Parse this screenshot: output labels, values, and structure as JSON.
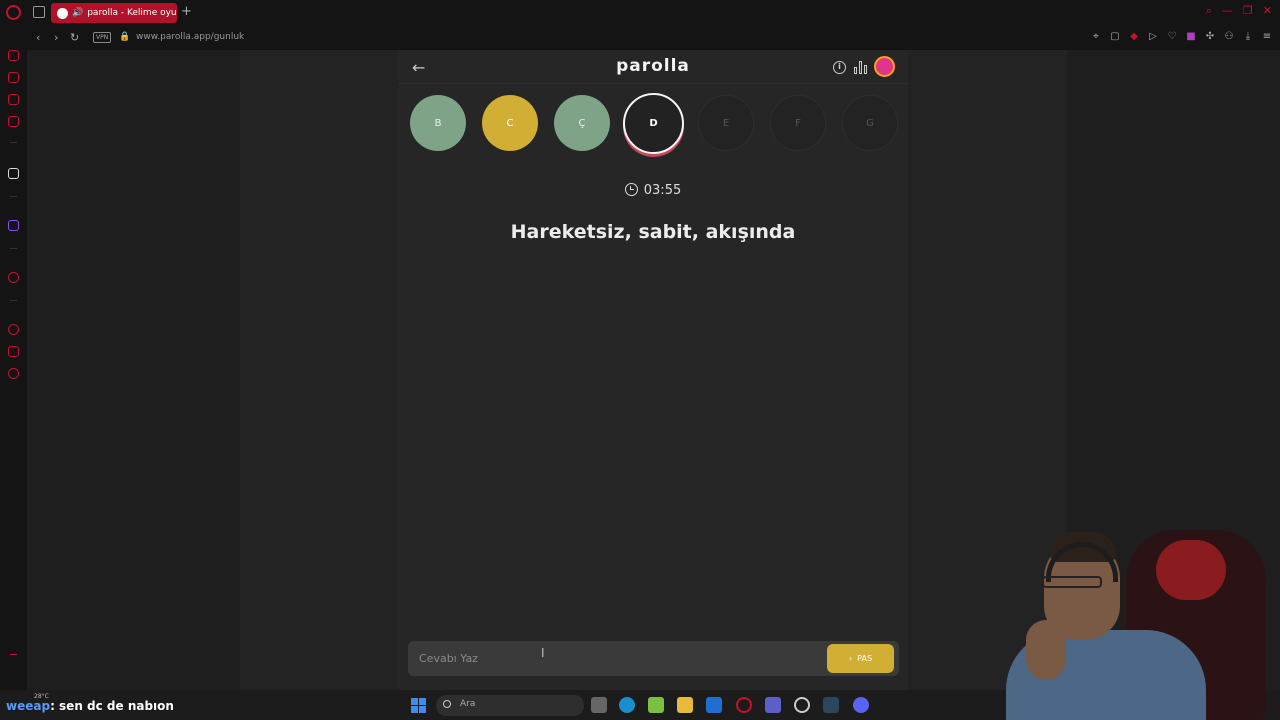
{
  "browser": {
    "tab_title": "parolla - Kelime oyunu",
    "url": "www.parolla.app/gunluk",
    "vpn_label": "VPN",
    "new_tab": "+"
  },
  "app": {
    "logo": "parolla",
    "letters": [
      {
        "char": "B",
        "state": "correct"
      },
      {
        "char": "C",
        "state": "passed"
      },
      {
        "char": "Ç",
        "state": "correct"
      },
      {
        "char": "D",
        "state": "current"
      },
      {
        "char": "E",
        "state": "pending"
      },
      {
        "char": "F",
        "state": "pending"
      },
      {
        "char": "G",
        "state": "pending"
      }
    ],
    "timer": "03:55",
    "question": "Hareketsiz, sabit, akışında",
    "answer_placeholder": "Cevabı Yaz",
    "pas_label": "PAS"
  },
  "overlay": {
    "chat_user": "weeap",
    "chat_message": ": sen dc de nabıon",
    "weather": "28°C"
  },
  "taskbar": {
    "search_label": "Ara"
  },
  "colors": {
    "correct": "#7ea387",
    "passed": "#d1ae34",
    "opera_red": "#c8102e"
  }
}
